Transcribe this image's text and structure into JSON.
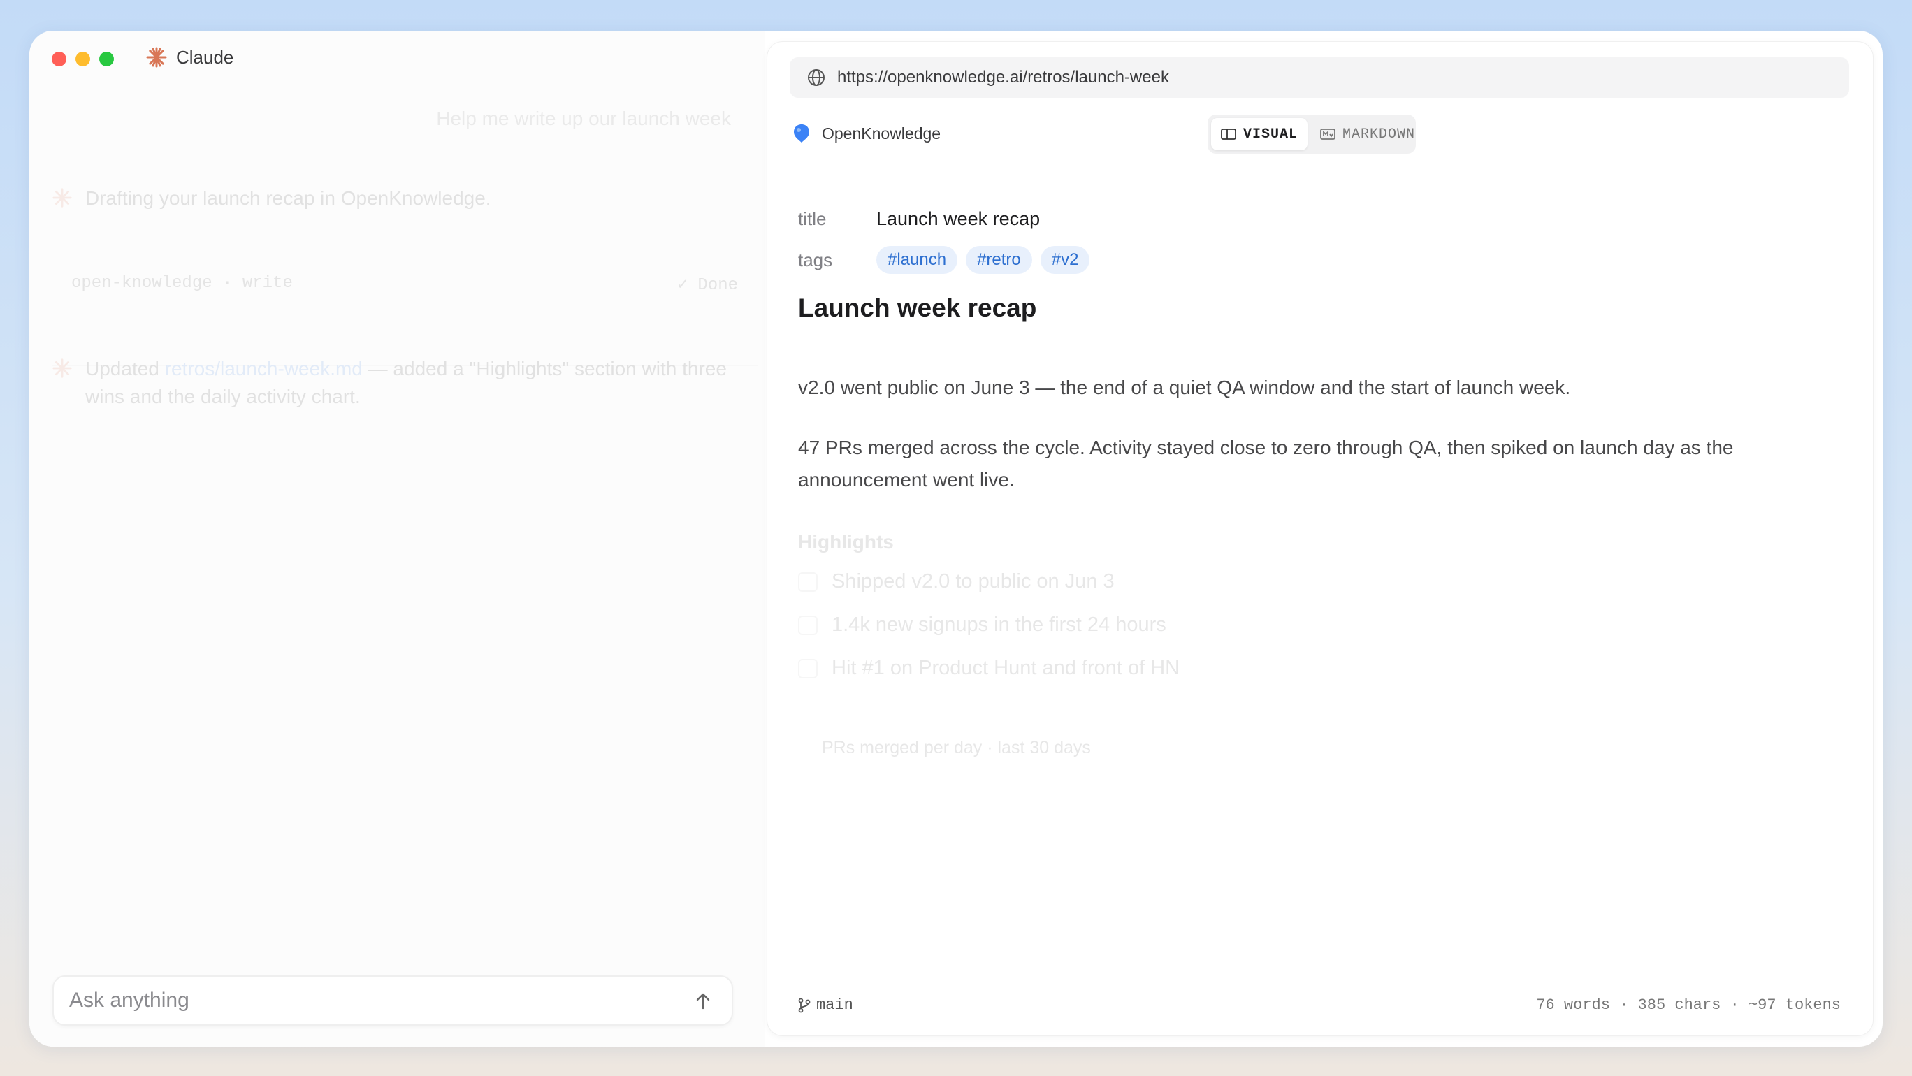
{
  "app": {
    "name": "Claude"
  },
  "chat": {
    "user_message": "Help me write up our launch week",
    "assistant_intro": "Drafting your launch recap in OpenKnowledge.",
    "tool_call": {
      "name": "open-knowledge · write",
      "status": "✓ Done"
    },
    "assistant_update": {
      "prefix": "Updated ",
      "file_link": "retros/launch-week.md",
      "suffix": " — added a \"Highlights\" section with three wins and the daily activity chart."
    },
    "composer": {
      "placeholder": "Ask anything"
    }
  },
  "doc": {
    "url": "https://openknowledge.ai/retros/launch-week",
    "app_name": "OpenKnowledge",
    "modes": {
      "visual": "VISUAL",
      "markdown": "MARKDOWN",
      "active": "visual"
    },
    "frontmatter": {
      "title_key": "title",
      "title_value": "Launch week recap",
      "tags_key": "tags",
      "tags": [
        "#launch",
        "#retro",
        "#v2"
      ]
    },
    "heading": "Launch week recap",
    "paragraphs": [
      "v2.0 went public on June 3 — the end of a quiet QA window and the start of launch week.",
      "47 PRs merged across the cycle. Activity stayed close to zero through QA, then spiked on launch day as the announcement went live."
    ],
    "highlights_title": "Highlights",
    "highlights": [
      "Shipped v2.0 to public on Jun 3",
      "1.4k new signups in the first 24 hours",
      "Hit #1 on Product Hunt and front of HN"
    ],
    "chart_caption": "PRs merged per day · last 30 days",
    "footer": {
      "branch": "main",
      "stats": "76 words · 385 chars · ~97 tokens"
    }
  },
  "colors": {
    "accent": "#3b7fe0",
    "tag_bg": "#e8f0fc",
    "claude_orange": "#d97757"
  }
}
